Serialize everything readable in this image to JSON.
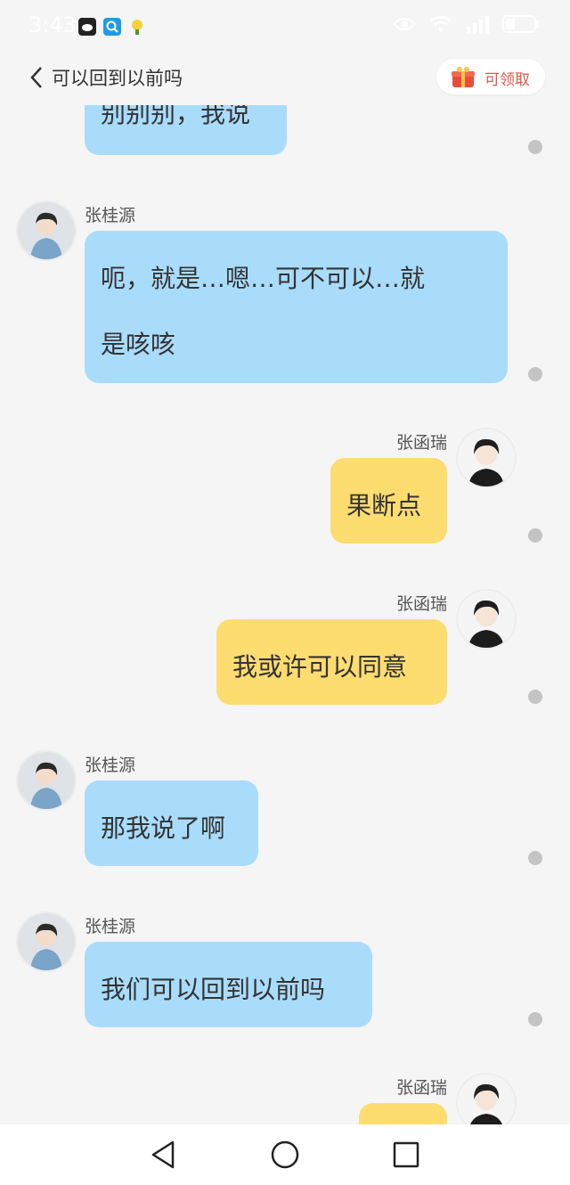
{
  "status_bar": {
    "time": "3:43",
    "icons": [
      "message-app-icon",
      "search-app-icon",
      "lottery-app-icon",
      "eye-icon",
      "wifi-icon",
      "signal-icon",
      "battery-icon"
    ]
  },
  "header": {
    "title": "可以回到以前吗",
    "reward_label": "可领取"
  },
  "messages": [
    {
      "side": "left",
      "sender": "",
      "text": "别别别，我说"
    },
    {
      "side": "left",
      "sender": "张桂源",
      "lines": [
        "呃，就是…嗯…可不可以…就",
        "是咳咳"
      ]
    },
    {
      "side": "right",
      "sender": "张函瑞",
      "text": "果断点"
    },
    {
      "side": "right",
      "sender": "张函瑞",
      "text": "我或许可以同意"
    },
    {
      "side": "left",
      "sender": "张桂源",
      "text": "那我说了啊"
    },
    {
      "side": "left",
      "sender": "张桂源",
      "text": "我们可以回到以前吗"
    },
    {
      "side": "right",
      "sender": "张函瑞",
      "text": ""
    }
  ],
  "colors": {
    "left_bubble": "#a9dcfb",
    "right_bubble": "#fddc70",
    "background": "#f5f5f5",
    "read_dot": "#c4c4c4"
  },
  "nav": {
    "icons": [
      "back-triangle-icon",
      "home-circle-icon",
      "recents-square-icon"
    ]
  }
}
